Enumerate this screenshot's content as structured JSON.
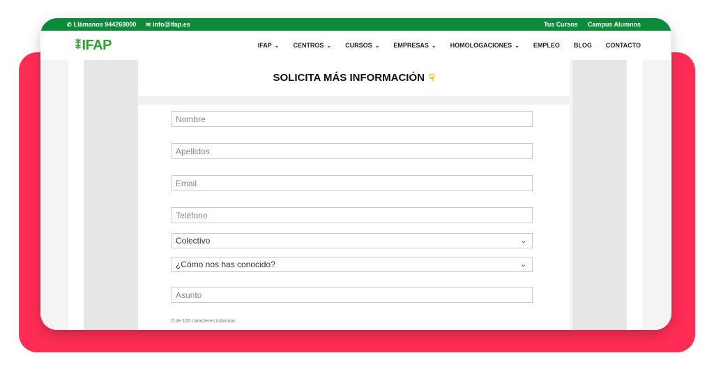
{
  "topbar": {
    "phone_label": "Llámanos 944269000",
    "email_label": "info@ifap.es",
    "links": [
      "Tus Cursos",
      "Campus Alumnos"
    ]
  },
  "logo": {
    "text": "IFAP"
  },
  "nav": {
    "items": [
      {
        "label": "IFAP",
        "has_dropdown": true
      },
      {
        "label": "CENTROS",
        "has_dropdown": true
      },
      {
        "label": "CURSOS",
        "has_dropdown": true
      },
      {
        "label": "EMPRESAS",
        "has_dropdown": true
      },
      {
        "label": "HOMOLOGACIONES",
        "has_dropdown": true
      },
      {
        "label": "EMPLEO",
        "has_dropdown": false
      },
      {
        "label": "BLOG",
        "has_dropdown": false
      },
      {
        "label": "CONTACTO",
        "has_dropdown": false
      }
    ]
  },
  "form": {
    "title": "SOLICITA MÁS INFORMACIÓN",
    "title_icon": "pointing-down-hand-icon",
    "fields": {
      "nombre": "Nombre",
      "apellidos": "Apellidos",
      "email": "Email",
      "telefono": "Teléfono",
      "colectivo": "Colectivo",
      "conocido": "¿Cómo nos has conocido?",
      "asunto": "Asunto"
    },
    "counter": "0 de 100 caracteres máximos"
  },
  "colors": {
    "brand_green": "#0b8a3a",
    "logo_green": "#2aa52e",
    "accent_red": "#ff2d55"
  }
}
